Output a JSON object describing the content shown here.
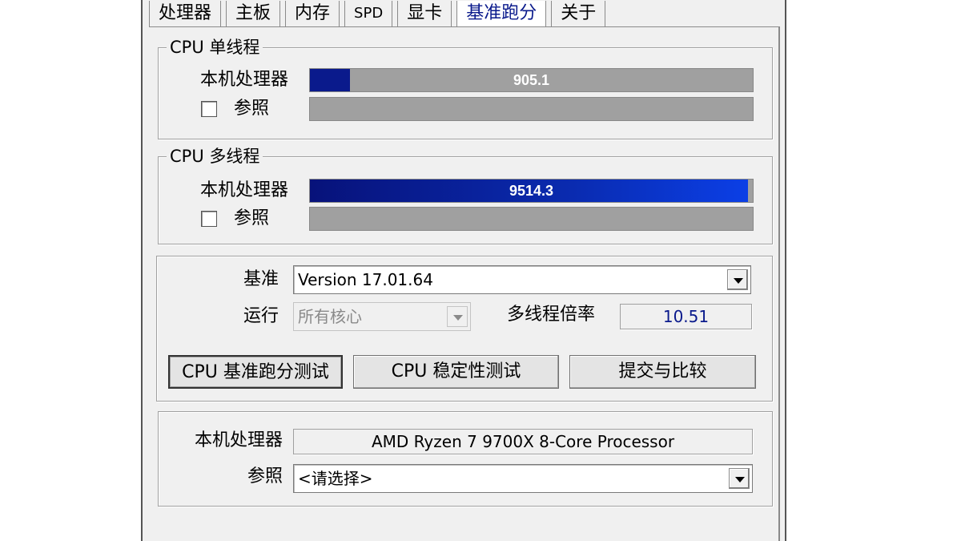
{
  "tabs": [
    {
      "label": "处理器"
    },
    {
      "label": "主板"
    },
    {
      "label": "内存"
    },
    {
      "label": "SPD"
    },
    {
      "label": "显卡"
    },
    {
      "label": "基准跑分"
    },
    {
      "label": "关于"
    }
  ],
  "active_tab": "基准跑分",
  "single_thread": {
    "legend": "CPU 单线程",
    "this_cpu_label": "本机处理器",
    "this_cpu_score": "905.1",
    "this_cpu_fill": 0.09,
    "reference_label": "参照",
    "reference_checked": false
  },
  "multi_thread": {
    "legend": "CPU 多线程",
    "this_cpu_label": "本机处理器",
    "this_cpu_score": "9514.3",
    "this_cpu_fill": 0.99,
    "reference_label": "参照",
    "reference_checked": false
  },
  "settings": {
    "benchmark_label": "基准",
    "benchmark_value": "Version 17.01.64",
    "run_label": "运行",
    "run_value": "所有核心",
    "ratio_label": "多线程倍率",
    "ratio_value": "10.51"
  },
  "buttons": {
    "bench": "CPU 基准跑分测试",
    "stress": "CPU 稳定性测试",
    "submit": "提交与比较"
  },
  "info": {
    "this_cpu_label": "本机处理器",
    "this_cpu_value": "AMD Ryzen 7 9700X 8-Core Processor",
    "reference_label": "参照",
    "reference_value": "<请选择>"
  },
  "colors": {
    "single_fill": "#0a1a8c",
    "multi_fill": "#0b3fe6",
    "bar_track": "#a0a0a0",
    "ratio_text": "#0a1a8c",
    "active_tab_text": "#0a1a8c"
  }
}
